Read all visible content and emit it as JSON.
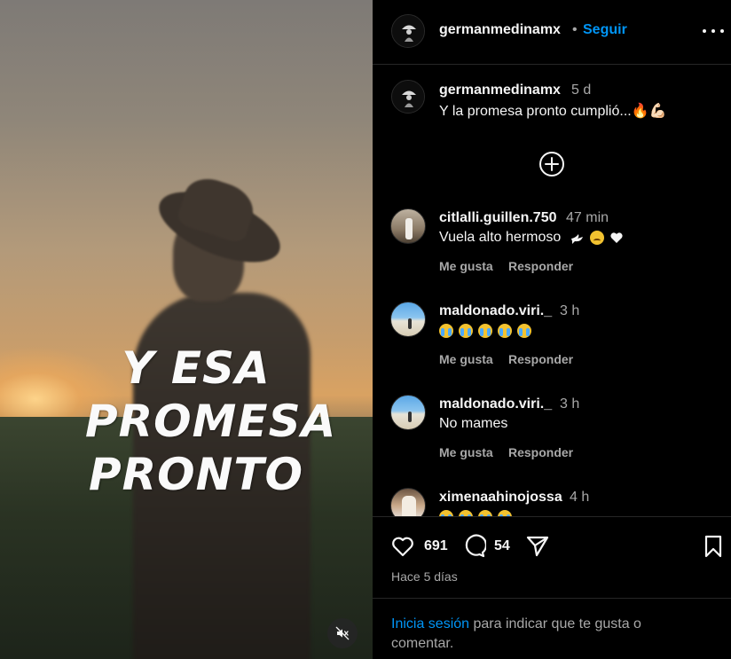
{
  "post": {
    "overlay_lines": [
      "Y ESA",
      "PROMESA",
      "PRONTO"
    ]
  },
  "header": {
    "username": "germanmedinamx",
    "separator": "•",
    "follow_label": "Seguir"
  },
  "caption": {
    "username": "germanmedinamx",
    "time": "5 d",
    "text": "Y la promesa pronto cumplió...🔥💪🏻"
  },
  "comments": [
    {
      "username": "citlalli.guillen.750",
      "time": "47 min",
      "text": "Vuela alto hermoso",
      "emojis": [
        "dove",
        "sad",
        "white-heart"
      ],
      "like_label": "Me gusta",
      "reply_label": "Responder"
    },
    {
      "username": "maldonado.viri._",
      "time": "3 h",
      "text": "",
      "emojis": [
        "crying",
        "crying",
        "crying",
        "crying",
        "crying"
      ],
      "like_label": "Me gusta",
      "reply_label": "Responder"
    },
    {
      "username": "maldonado.viri._",
      "time": "3 h",
      "text": "No mames",
      "like_label": "Me gusta",
      "reply_label": "Responder"
    },
    {
      "username": "ximenaahinojossa",
      "time": "4 h",
      "text": "",
      "emojis": [
        "crying",
        "crying",
        "crying",
        "crying"
      ]
    }
  ],
  "actions": {
    "like_count": "691",
    "comment_count": "54",
    "date": "Hace 5 días"
  },
  "login": {
    "link_text": "Inicia sesión",
    "rest_text": " para indicar que te gusta o comentar."
  },
  "colors": {
    "accent": "#0095f6",
    "background": "#000000",
    "muted_text": "#a8a8a8",
    "divider": "#262626"
  }
}
